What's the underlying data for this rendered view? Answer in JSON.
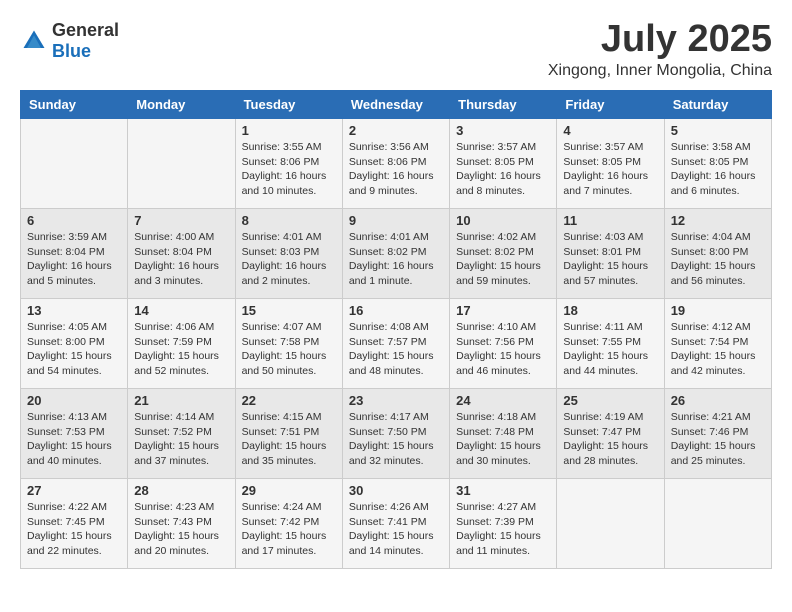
{
  "header": {
    "logo": {
      "general": "General",
      "blue": "Blue"
    },
    "title": "July 2025",
    "location": "Xingong, Inner Mongolia, China"
  },
  "calendar": {
    "days_of_week": [
      "Sunday",
      "Monday",
      "Tuesday",
      "Wednesday",
      "Thursday",
      "Friday",
      "Saturday"
    ],
    "weeks": [
      [
        {
          "day": "",
          "info": ""
        },
        {
          "day": "",
          "info": ""
        },
        {
          "day": "1",
          "info": "Sunrise: 3:55 AM\nSunset: 8:06 PM\nDaylight: 16 hours and 10 minutes."
        },
        {
          "day": "2",
          "info": "Sunrise: 3:56 AM\nSunset: 8:06 PM\nDaylight: 16 hours and 9 minutes."
        },
        {
          "day": "3",
          "info": "Sunrise: 3:57 AM\nSunset: 8:05 PM\nDaylight: 16 hours and 8 minutes."
        },
        {
          "day": "4",
          "info": "Sunrise: 3:57 AM\nSunset: 8:05 PM\nDaylight: 16 hours and 7 minutes."
        },
        {
          "day": "5",
          "info": "Sunrise: 3:58 AM\nSunset: 8:05 PM\nDaylight: 16 hours and 6 minutes."
        }
      ],
      [
        {
          "day": "6",
          "info": "Sunrise: 3:59 AM\nSunset: 8:04 PM\nDaylight: 16 hours and 5 minutes."
        },
        {
          "day": "7",
          "info": "Sunrise: 4:00 AM\nSunset: 8:04 PM\nDaylight: 16 hours and 3 minutes."
        },
        {
          "day": "8",
          "info": "Sunrise: 4:01 AM\nSunset: 8:03 PM\nDaylight: 16 hours and 2 minutes."
        },
        {
          "day": "9",
          "info": "Sunrise: 4:01 AM\nSunset: 8:02 PM\nDaylight: 16 hours and 1 minute."
        },
        {
          "day": "10",
          "info": "Sunrise: 4:02 AM\nSunset: 8:02 PM\nDaylight: 15 hours and 59 minutes."
        },
        {
          "day": "11",
          "info": "Sunrise: 4:03 AM\nSunset: 8:01 PM\nDaylight: 15 hours and 57 minutes."
        },
        {
          "day": "12",
          "info": "Sunrise: 4:04 AM\nSunset: 8:00 PM\nDaylight: 15 hours and 56 minutes."
        }
      ],
      [
        {
          "day": "13",
          "info": "Sunrise: 4:05 AM\nSunset: 8:00 PM\nDaylight: 15 hours and 54 minutes."
        },
        {
          "day": "14",
          "info": "Sunrise: 4:06 AM\nSunset: 7:59 PM\nDaylight: 15 hours and 52 minutes."
        },
        {
          "day": "15",
          "info": "Sunrise: 4:07 AM\nSunset: 7:58 PM\nDaylight: 15 hours and 50 minutes."
        },
        {
          "day": "16",
          "info": "Sunrise: 4:08 AM\nSunset: 7:57 PM\nDaylight: 15 hours and 48 minutes."
        },
        {
          "day": "17",
          "info": "Sunrise: 4:10 AM\nSunset: 7:56 PM\nDaylight: 15 hours and 46 minutes."
        },
        {
          "day": "18",
          "info": "Sunrise: 4:11 AM\nSunset: 7:55 PM\nDaylight: 15 hours and 44 minutes."
        },
        {
          "day": "19",
          "info": "Sunrise: 4:12 AM\nSunset: 7:54 PM\nDaylight: 15 hours and 42 minutes."
        }
      ],
      [
        {
          "day": "20",
          "info": "Sunrise: 4:13 AM\nSunset: 7:53 PM\nDaylight: 15 hours and 40 minutes."
        },
        {
          "day": "21",
          "info": "Sunrise: 4:14 AM\nSunset: 7:52 PM\nDaylight: 15 hours and 37 minutes."
        },
        {
          "day": "22",
          "info": "Sunrise: 4:15 AM\nSunset: 7:51 PM\nDaylight: 15 hours and 35 minutes."
        },
        {
          "day": "23",
          "info": "Sunrise: 4:17 AM\nSunset: 7:50 PM\nDaylight: 15 hours and 32 minutes."
        },
        {
          "day": "24",
          "info": "Sunrise: 4:18 AM\nSunset: 7:48 PM\nDaylight: 15 hours and 30 minutes."
        },
        {
          "day": "25",
          "info": "Sunrise: 4:19 AM\nSunset: 7:47 PM\nDaylight: 15 hours and 28 minutes."
        },
        {
          "day": "26",
          "info": "Sunrise: 4:21 AM\nSunset: 7:46 PM\nDaylight: 15 hours and 25 minutes."
        }
      ],
      [
        {
          "day": "27",
          "info": "Sunrise: 4:22 AM\nSunset: 7:45 PM\nDaylight: 15 hours and 22 minutes."
        },
        {
          "day": "28",
          "info": "Sunrise: 4:23 AM\nSunset: 7:43 PM\nDaylight: 15 hours and 20 minutes."
        },
        {
          "day": "29",
          "info": "Sunrise: 4:24 AM\nSunset: 7:42 PM\nDaylight: 15 hours and 17 minutes."
        },
        {
          "day": "30",
          "info": "Sunrise: 4:26 AM\nSunset: 7:41 PM\nDaylight: 15 hours and 14 minutes."
        },
        {
          "day": "31",
          "info": "Sunrise: 4:27 AM\nSunset: 7:39 PM\nDaylight: 15 hours and 11 minutes."
        },
        {
          "day": "",
          "info": ""
        },
        {
          "day": "",
          "info": ""
        }
      ]
    ]
  }
}
